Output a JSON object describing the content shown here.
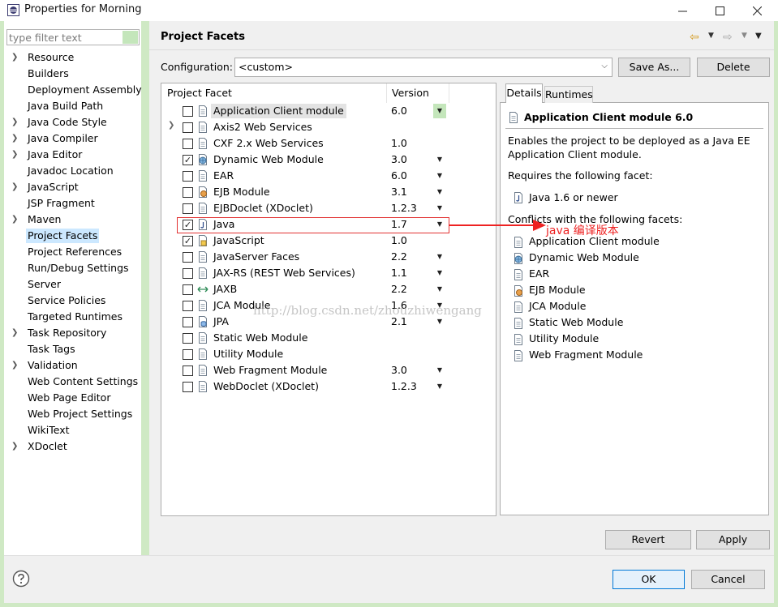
{
  "window": {
    "title": "Properties for Morning"
  },
  "filter": {
    "placeholder": "type filter text"
  },
  "tree": {
    "items": [
      {
        "label": "Resource",
        "expandable": true
      },
      {
        "label": "Builders",
        "expandable": false
      },
      {
        "label": "Deployment Assembly",
        "expandable": false
      },
      {
        "label": "Java Build Path",
        "expandable": false
      },
      {
        "label": "Java Code Style",
        "expandable": true
      },
      {
        "label": "Java Compiler",
        "expandable": true
      },
      {
        "label": "Java Editor",
        "expandable": true
      },
      {
        "label": "Javadoc Location",
        "expandable": false
      },
      {
        "label": "JavaScript",
        "expandable": true
      },
      {
        "label": "JSP Fragment",
        "expandable": false
      },
      {
        "label": "Maven",
        "expandable": true
      },
      {
        "label": "Project Facets",
        "expandable": false,
        "selected": true
      },
      {
        "label": "Project References",
        "expandable": false
      },
      {
        "label": "Run/Debug Settings",
        "expandable": false
      },
      {
        "label": "Server",
        "expandable": false
      },
      {
        "label": "Service Policies",
        "expandable": false
      },
      {
        "label": "Targeted Runtimes",
        "expandable": false
      },
      {
        "label": "Task Repository",
        "expandable": true
      },
      {
        "label": "Task Tags",
        "expandable": false
      },
      {
        "label": "Validation",
        "expandable": true
      },
      {
        "label": "Web Content Settings",
        "expandable": false
      },
      {
        "label": "Web Page Editor",
        "expandable": false
      },
      {
        "label": "Web Project Settings",
        "expandable": false
      },
      {
        "label": "WikiText",
        "expandable": false
      },
      {
        "label": "XDoclet",
        "expandable": true
      }
    ]
  },
  "header": {
    "title": "Project Facets"
  },
  "config": {
    "label": "Configuration:",
    "value": "<custom>",
    "save_as_label": "Save As...",
    "delete_label": "Delete"
  },
  "facets": {
    "col_facet": "Project Facet",
    "col_version": "Version",
    "rows": [
      {
        "name": "Application Client module",
        "version": "6.0",
        "checked": false,
        "icon": "page-icon",
        "dropdown": true,
        "active_dropdown": true,
        "selected": true
      },
      {
        "name": "Axis2 Web Services",
        "version": "",
        "checked": false,
        "icon": "page-icon",
        "dropdown": false,
        "expandable": true
      },
      {
        "name": "CXF 2.x Web Services",
        "version": "1.0",
        "checked": false,
        "icon": "page-icon",
        "dropdown": false
      },
      {
        "name": "Dynamic Web Module",
        "version": "3.0",
        "checked": true,
        "icon": "web-module-icon",
        "dropdown": true
      },
      {
        "name": "EAR",
        "version": "6.0",
        "checked": false,
        "icon": "page-icon",
        "dropdown": true
      },
      {
        "name": "EJB Module",
        "version": "3.1",
        "checked": false,
        "icon": "ejb-icon",
        "dropdown": true
      },
      {
        "name": "EJBDoclet (XDoclet)",
        "version": "1.2.3",
        "checked": false,
        "icon": "page-icon",
        "dropdown": true
      },
      {
        "name": "Java",
        "version": "1.7",
        "checked": true,
        "icon": "java-icon",
        "dropdown": true
      },
      {
        "name": "JavaScript",
        "version": "1.0",
        "checked": true,
        "icon": "javascript-icon",
        "dropdown": false
      },
      {
        "name": "JavaServer Faces",
        "version": "2.2",
        "checked": false,
        "icon": "page-icon",
        "dropdown": true
      },
      {
        "name": "JAX-RS (REST Web Services)",
        "version": "1.1",
        "checked": false,
        "icon": "page-icon",
        "dropdown": true
      },
      {
        "name": "JAXB",
        "version": "2.2",
        "checked": false,
        "icon": "jaxb-icon",
        "dropdown": true
      },
      {
        "name": "JCA Module",
        "version": "1.6",
        "checked": false,
        "icon": "page-icon",
        "dropdown": true
      },
      {
        "name": "JPA",
        "version": "2.1",
        "checked": false,
        "icon": "jpa-icon",
        "dropdown": true
      },
      {
        "name": "Static Web Module",
        "version": "",
        "checked": false,
        "icon": "page-icon",
        "dropdown": false
      },
      {
        "name": "Utility Module",
        "version": "",
        "checked": false,
        "icon": "page-icon",
        "dropdown": false
      },
      {
        "name": "Web Fragment Module",
        "version": "3.0",
        "checked": false,
        "icon": "page-icon",
        "dropdown": true
      },
      {
        "name": "WebDoclet (XDoclet)",
        "version": "1.2.3",
        "checked": false,
        "icon": "page-icon",
        "dropdown": true
      }
    ]
  },
  "details": {
    "tab_details": "Details",
    "tab_runtimes": "Runtimes",
    "title": "Application Client module 6.0",
    "description": "Enables the project to be deployed as a Java EE Application Client module.",
    "requires_label": "Requires the following facet:",
    "requires_item": "Java 1.6 or newer",
    "conflicts_label": "Conflicts with the following facets:",
    "conflicts": [
      {
        "label": "Application Client module",
        "icon": "page-icon"
      },
      {
        "label": "Dynamic Web Module",
        "icon": "web-module-icon"
      },
      {
        "label": "EAR",
        "icon": "page-icon"
      },
      {
        "label": "EJB Module",
        "icon": "ejb-icon"
      },
      {
        "label": "JCA Module",
        "icon": "page-icon"
      },
      {
        "label": "Static Web Module",
        "icon": "page-icon"
      },
      {
        "label": "Utility Module",
        "icon": "page-icon"
      },
      {
        "label": "Web Fragment Module",
        "icon": "page-icon"
      }
    ]
  },
  "annotation": {
    "text": "java 编译版本"
  },
  "watermark": {
    "text": "http://blog.csdn.net/zhouzhiwengang"
  },
  "buttons": {
    "revert": "Revert",
    "apply": "Apply",
    "ok": "OK",
    "cancel": "Cancel"
  },
  "colors": {
    "frame": "#cfe9c4",
    "annotation": "#ee2222",
    "selection": "#cce8ff",
    "primary_button_border": "#0078d7"
  }
}
